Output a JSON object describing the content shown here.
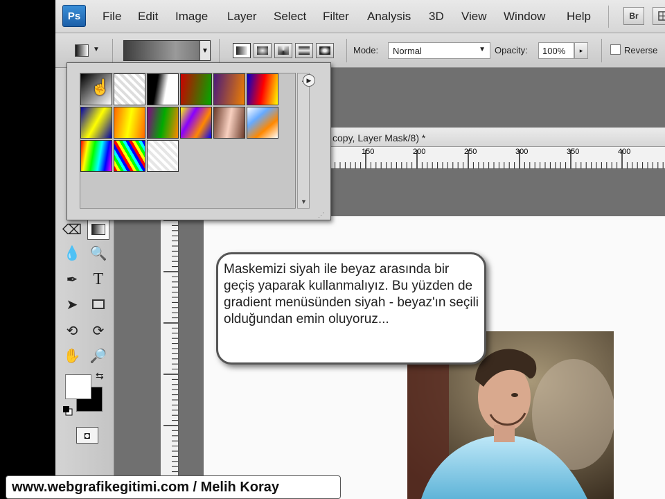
{
  "app": {
    "logo": "Ps"
  },
  "menu": {
    "items": [
      "File",
      "Edit",
      "Image",
      "Layer",
      "Select",
      "Filter",
      "Analysis",
      "3D",
      "View",
      "Window",
      "Help"
    ],
    "bridge_label": "Br"
  },
  "options_bar": {
    "mode_label": "Mode:",
    "mode_value": "Normal",
    "opacity_label": "Opacity:",
    "opacity_value": "100%",
    "reverse_label": "Reverse"
  },
  "gradient_picker": {
    "swatches": [
      {
        "name": "black-white"
      },
      {
        "name": "transparent-stripes"
      },
      {
        "name": "black-white-diagonal"
      },
      {
        "name": "red-green"
      },
      {
        "name": "violet-orange"
      },
      {
        "name": "blue-red-yellow"
      },
      {
        "name": "blue-yellow-blue"
      },
      {
        "name": "orange-yellow-orange"
      },
      {
        "name": "violet-green-orange"
      },
      {
        "name": "yellow-violet-orange-blue"
      },
      {
        "name": "copper"
      },
      {
        "name": "chrome"
      },
      {
        "name": "spectrum"
      },
      {
        "name": "transparent-rainbow"
      },
      {
        "name": "transparent-checker"
      }
    ]
  },
  "document": {
    "title_fragment": "copy, Layer Mask/8) *",
    "ruler_ticks": [
      "150",
      "200",
      "250",
      "300",
      "350",
      "400"
    ]
  },
  "callout": {
    "text": "Maskemizi siyah ile beyaz arasında bir geçiş yaparak kullanmalıyız. Bu yüzden de gradient menüsünden siyah - beyaz'ın seçili olduğundan emin oluyoruz..."
  },
  "watermark": {
    "text": "www.webgrafikegitimi.com / Melih Koray"
  },
  "icons": [
    "photoshop-logo-icon",
    "eraser-icon",
    "gradient-icon",
    "blur-drop-icon",
    "dodge-icon",
    "pen-icon",
    "type-icon",
    "path-select-icon",
    "rectangle-shape-icon",
    "3d-rotate-icon",
    "3d-orbit-icon",
    "hand-icon",
    "zoom-icon",
    "swap-colors-icon",
    "default-colors-icon",
    "quick-mask-icon",
    "menu-arrow-icon",
    "scroll-up-icon",
    "scroll-down-icon",
    "hand-cursor-icon"
  ]
}
